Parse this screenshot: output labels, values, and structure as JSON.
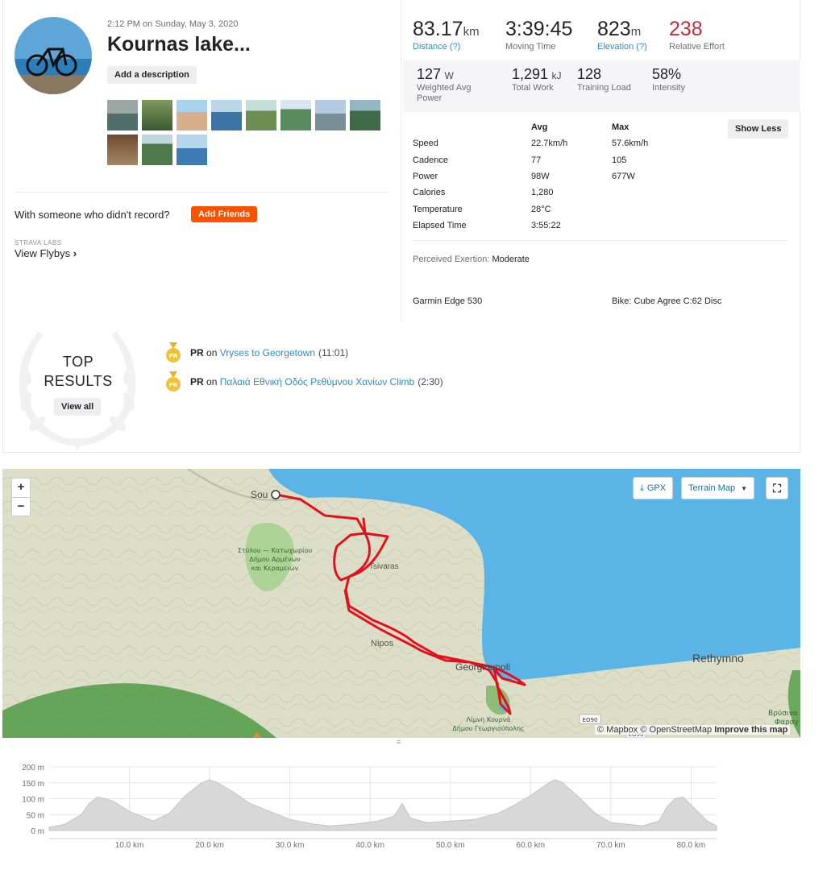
{
  "activity": {
    "date": "2:12 PM on Sunday, May 3, 2020",
    "title": "Kournas lake...",
    "add_description": "Add a description",
    "with_question": "With someone who didn't record?",
    "add_friends": "Add Friends",
    "labs_label": "STRAVA LABS",
    "view_flybys": "View Flybys"
  },
  "stats": {
    "distance_value": "83.17",
    "distance_unit": "km",
    "distance_label": "Distance (?)",
    "moving_time_value": "3:39:45",
    "moving_time_label": "Moving Time",
    "elevation_value": "823",
    "elevation_unit": "m",
    "elevation_label": "Elevation (?)",
    "relative_effort_value": "238",
    "relative_effort_label": "Relative Effort",
    "wap_value": "127",
    "wap_unit": "W",
    "wap_label_1": "Weighted Avg",
    "wap_label_2": "Power",
    "work_value": "1,291",
    "work_unit": "kJ",
    "work_label": "Total Work",
    "load_value": "128",
    "load_label": "Training Load",
    "intensity_value": "58%",
    "intensity_label": "Intensity"
  },
  "details": {
    "avg_header": "Avg",
    "max_header": "Max",
    "show_less": "Show Less",
    "rows": [
      {
        "label": "Speed",
        "avg": "22.7km/h",
        "max": "57.6km/h"
      },
      {
        "label": "Cadence",
        "avg": "77",
        "max": "105"
      },
      {
        "label": "Power",
        "avg": "98W",
        "max": "677W"
      },
      {
        "label": "Calories",
        "avg": "1,280",
        "max": ""
      },
      {
        "label": "Temperature",
        "avg": "28°C",
        "max": ""
      },
      {
        "label": "Elapsed Time",
        "avg": "3:55:22",
        "max": ""
      }
    ],
    "exertion_label": "Perceived Exertion:",
    "exertion_value": "Moderate",
    "device": "Garmin Edge 530",
    "bike": "Bike: Cube Agree C:62 Disc"
  },
  "top_results": {
    "title_1": "TOP",
    "title_2": "RESULTS",
    "view_all": "View all",
    "items": [
      {
        "badge": "PR",
        "on": "on",
        "segment": "Vryses to Georgetown",
        "time": "(11:01)"
      },
      {
        "badge": "PR",
        "on": "on",
        "segment": "Παλαιά Εθνική Οδός Ρεθύμνου Χανίων Climb",
        "time": "(2:30)"
      }
    ]
  },
  "map": {
    "zoom_in": "+",
    "zoom_out": "−",
    "gpx": "GPX",
    "terrain": "Terrain Map",
    "attribution_1": "© Mapbox © OpenStreetMap",
    "attribution_2": "Improve this map",
    "places": {
      "souda": "Sou",
      "tsivaras": "Tsivaras",
      "nipos": "Nipos",
      "georgioupoli": "Georgioupoli",
      "rethymno": "Rethymno",
      "stylos_1": "Στύλου — Κατωχωρίου",
      "stylos_2": "Δήμου Αρμένων",
      "stylos_3": "και Κεραμειών",
      "kourna_1": "Λίμνη Κουρνά",
      "kourna_2": "Δήμου Γεωργιούπολης",
      "vrysina": "Βρύσινα",
      "farago": "Φαραγ",
      "eo90": "ΕΟ90",
      "eo90b": "ΕΟ90"
    },
    "colors": {
      "sea": "#5ab4e5",
      "route": "#e3111c",
      "land": "#d9dcc3"
    }
  },
  "chart_data": {
    "type": "area",
    "ylabel_ticks": [
      "0 m",
      "50 m",
      "100 m",
      "150 m",
      "200 m"
    ],
    "xlabel_ticks": [
      "10.0 km",
      "20.0 km",
      "30.0 km",
      "40.0 km",
      "50.0 km",
      "60.0 km",
      "70.0 km",
      "80.0 km"
    ],
    "xlim": [
      0,
      83.17
    ],
    "ylim": [
      0,
      200
    ],
    "grid": true,
    "x": [
      0,
      2,
      4,
      5,
      6,
      7,
      8,
      10,
      13,
      15,
      17,
      19,
      20,
      21,
      23,
      25,
      27,
      30,
      33,
      35,
      38,
      41,
      43,
      44,
      45,
      47,
      50,
      53,
      56,
      58,
      60,
      62,
      63,
      64,
      66,
      68,
      70,
      72,
      74,
      76,
      77,
      78,
      79,
      80,
      82,
      83.17
    ],
    "values": [
      10,
      20,
      50,
      85,
      105,
      100,
      92,
      60,
      30,
      55,
      110,
      150,
      160,
      150,
      120,
      85,
      65,
      35,
      20,
      15,
      20,
      30,
      45,
      85,
      40,
      25,
      30,
      35,
      55,
      80,
      110,
      145,
      160,
      150,
      105,
      55,
      25,
      20,
      15,
      30,
      75,
      100,
      105,
      80,
      30,
      15
    ],
    "color": "#d8d8d8"
  }
}
